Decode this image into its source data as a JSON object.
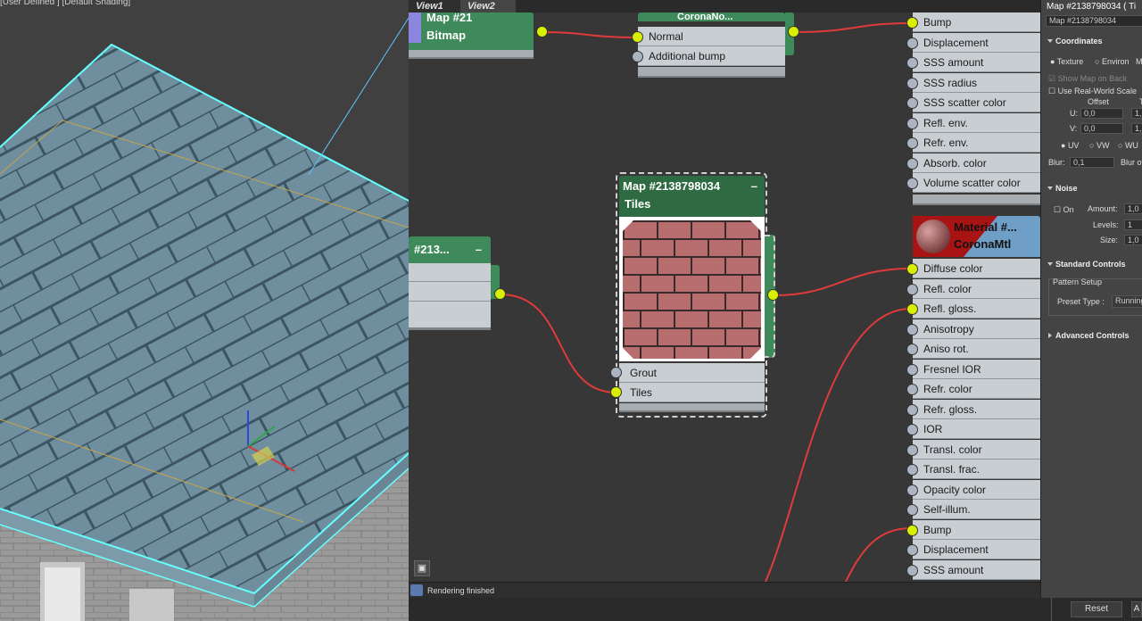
{
  "viewport": {
    "label": "[User Defined ] [Default Shading]"
  },
  "slate": {
    "tabs": [
      "View1",
      "View2"
    ],
    "nodes": {
      "bitmap": {
        "title1": "Map #21",
        "title2": "Bitmap"
      },
      "normal_map": {
        "title": "CoronaNo...",
        "slots": [
          "Normal",
          "Additional bump"
        ]
      },
      "left_map": {
        "title": "#213..."
      },
      "tiles": {
        "title1": "Map #2138798034",
        "title2": "Tiles",
        "slots": [
          "Grout",
          "Tiles"
        ]
      },
      "material_top": {
        "slots": [
          "Bump",
          "Displacement",
          "SSS amount",
          "SSS radius",
          "SSS scatter color",
          "Refl. env.",
          "Refr. env.",
          "Absorb. color",
          "Volume scatter color"
        ]
      },
      "material": {
        "title1": "Material  #...",
        "title2": "CoronaMtl",
        "slots": [
          "Diffuse color",
          "Refl. color",
          "Refl. gloss.",
          "Anisotropy",
          "Aniso rot.",
          "Fresnel IOR",
          "Refr. color",
          "Refr. gloss.",
          "IOR",
          "Transl. color",
          "Transl. frac.",
          "Opacity color",
          "Self-illum.",
          "Bump",
          "Displacement",
          "SSS amount"
        ]
      }
    },
    "status": "Rendering finished"
  },
  "panel": {
    "title": "Map #2138798034  ( Ti",
    "name_field": "Map #2138798034",
    "coordinates": {
      "header": "Coordinates",
      "texture": "Texture",
      "environ": "Environ",
      "environ_short": "M",
      "show_map": "Show Map on Back",
      "real_world": "Use Real-World Scale",
      "offset": "Offset",
      "t_col": "T",
      "u_label": "U:",
      "u_value": "0,0",
      "u_t": "1,",
      "v_label": "V:",
      "v_value": "0,0",
      "v_t": "1,",
      "uv": "UV",
      "vw": "VW",
      "wu": "WU",
      "blur": "Blur:",
      "blur_value": "0,1",
      "blur_off": "Blur of"
    },
    "noise": {
      "header": "Noise",
      "on": "On",
      "amount_label": "Amount:",
      "amount": "1,0",
      "levels_label": "Levels:",
      "levels": "1",
      "size_label": "Size:",
      "size": "1,0"
    },
    "standard": {
      "header": "Standard Controls",
      "pattern": "Pattern Setup",
      "preset_label": "Preset Type :",
      "preset_value": "Running"
    },
    "advanced": {
      "header": "Advanced Controls"
    }
  },
  "bottom": {
    "reset": "Reset",
    "apply": "A"
  }
}
